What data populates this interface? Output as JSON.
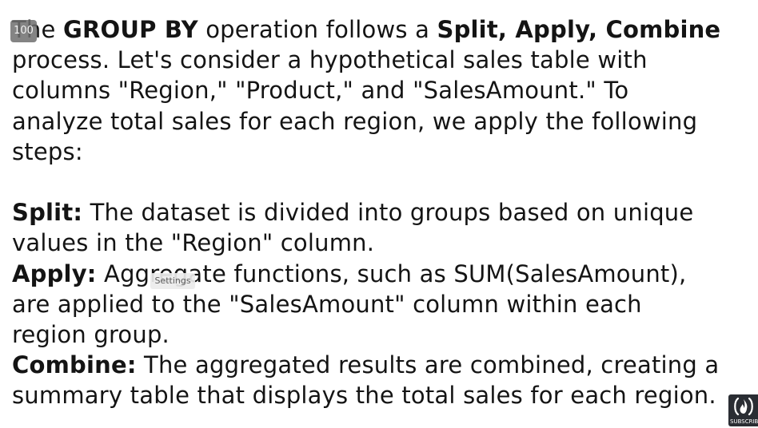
{
  "paragraph_intro": {
    "line1_pre": "The ",
    "line1_bold1": "GROUP BY",
    "line1_mid": " operation follows a ",
    "line1_bold2": "Split, Apply, Combine",
    "line2": "process. Let's consider a hypothetical sales table with",
    "line3": "columns \"Region,\" \"Product,\" and \"SalesAmount.\" To",
    "line4": "analyze total sales for each region, we apply the following",
    "line5": "steps:"
  },
  "steps": {
    "split_label": "Split:",
    "split_line1": " The dataset is divided into groups based on unique",
    "split_line2": "values in the \"Region\" column.",
    "apply_label": "Apply:",
    "apply_line1": " Aggregate functions, such as SUM(SalesAmount),",
    "apply_line2": "are applied to the \"SalesAmount\" column within each",
    "apply_line3": "region group.",
    "combine_label": "Combine:",
    "combine_line1": " The aggregated results are combined, creating a",
    "combine_line2": "summary table that displays the total sales for each region."
  },
  "overlays": {
    "volume_value": "100",
    "settings_tooltip": "Settings",
    "subscribe_label": "SUBSCRIBE"
  },
  "icons": {
    "subscribe": "freecodecamp-flame-icon"
  }
}
